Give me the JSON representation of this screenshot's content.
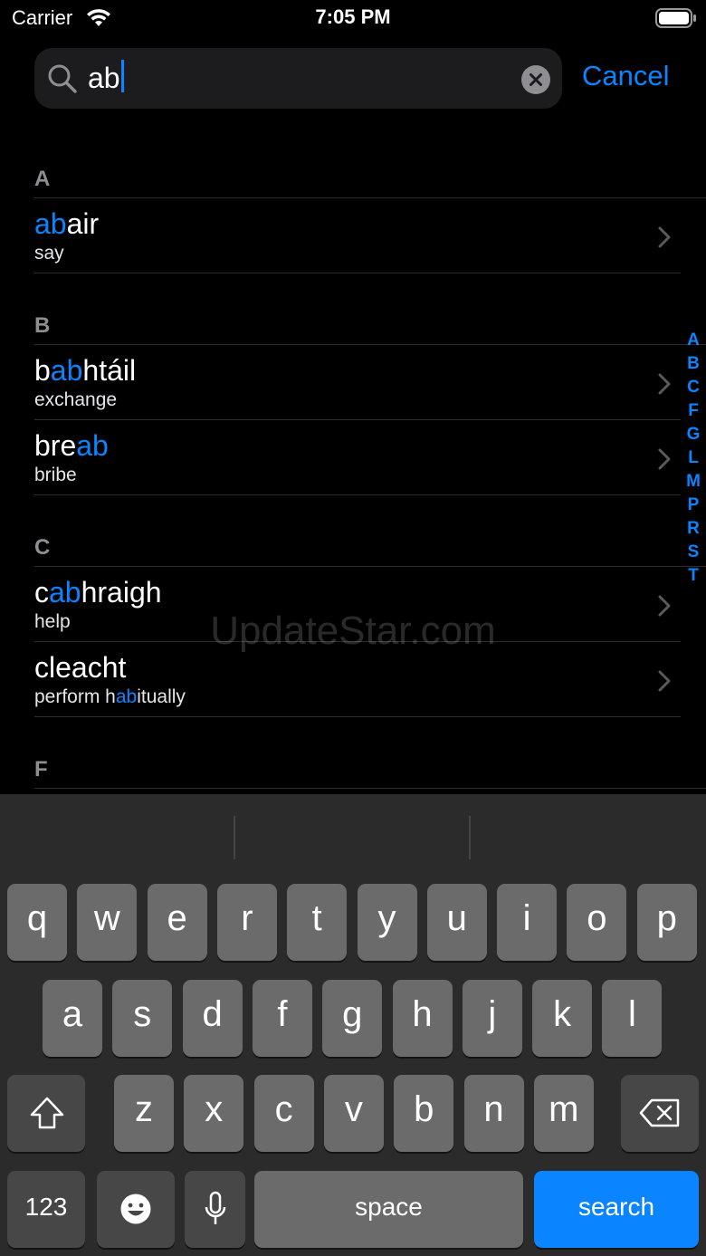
{
  "status_bar": {
    "carrier": "Carrier",
    "time": "7:05 PM"
  },
  "search": {
    "value": "ab",
    "cancel_label": "Cancel"
  },
  "sections": [
    {
      "letter": "A",
      "rows": [
        {
          "word": [
            [
              "ab",
              true
            ],
            [
              "air",
              false
            ]
          ],
          "translation": [
            [
              "say",
              false
            ]
          ]
        }
      ]
    },
    {
      "letter": "B",
      "rows": [
        {
          "word": [
            [
              "b",
              false
            ],
            [
              "ab",
              true
            ],
            [
              "htáil",
              false
            ]
          ],
          "translation": [
            [
              "exchange",
              false
            ]
          ]
        },
        {
          "word": [
            [
              "bre",
              false
            ],
            [
              "ab",
              true
            ]
          ],
          "translation": [
            [
              "bribe",
              false
            ]
          ]
        }
      ]
    },
    {
      "letter": "C",
      "rows": [
        {
          "word": [
            [
              "c",
              false
            ],
            [
              "ab",
              true
            ],
            [
              "hraigh",
              false
            ]
          ],
          "translation": [
            [
              "help",
              false
            ]
          ]
        },
        {
          "word": [
            [
              "cleacht",
              false
            ]
          ],
          "translation": [
            [
              "perform h",
              false
            ],
            [
              "ab",
              true
            ],
            [
              "itually",
              false
            ]
          ]
        }
      ]
    },
    {
      "letter": "F",
      "rows": []
    }
  ],
  "index_letters": [
    "A",
    "B",
    "C",
    "F",
    "G",
    "L",
    "M",
    "P",
    "R",
    "S",
    "T"
  ],
  "watermark": "UpdateStar.com",
  "keyboard": {
    "row1": [
      "q",
      "w",
      "e",
      "r",
      "t",
      "y",
      "u",
      "i",
      "o",
      "p"
    ],
    "row2": [
      "a",
      "s",
      "d",
      "f",
      "g",
      "h",
      "j",
      "k",
      "l"
    ],
    "row3": [
      "z",
      "x",
      "c",
      "v",
      "b",
      "n",
      "m"
    ],
    "numbers_label": "123",
    "space_label": "space",
    "search_label": "search"
  },
  "colors": {
    "accent": "#0a84ff",
    "background": "#000000",
    "keyboard": "#2b2b2b"
  }
}
